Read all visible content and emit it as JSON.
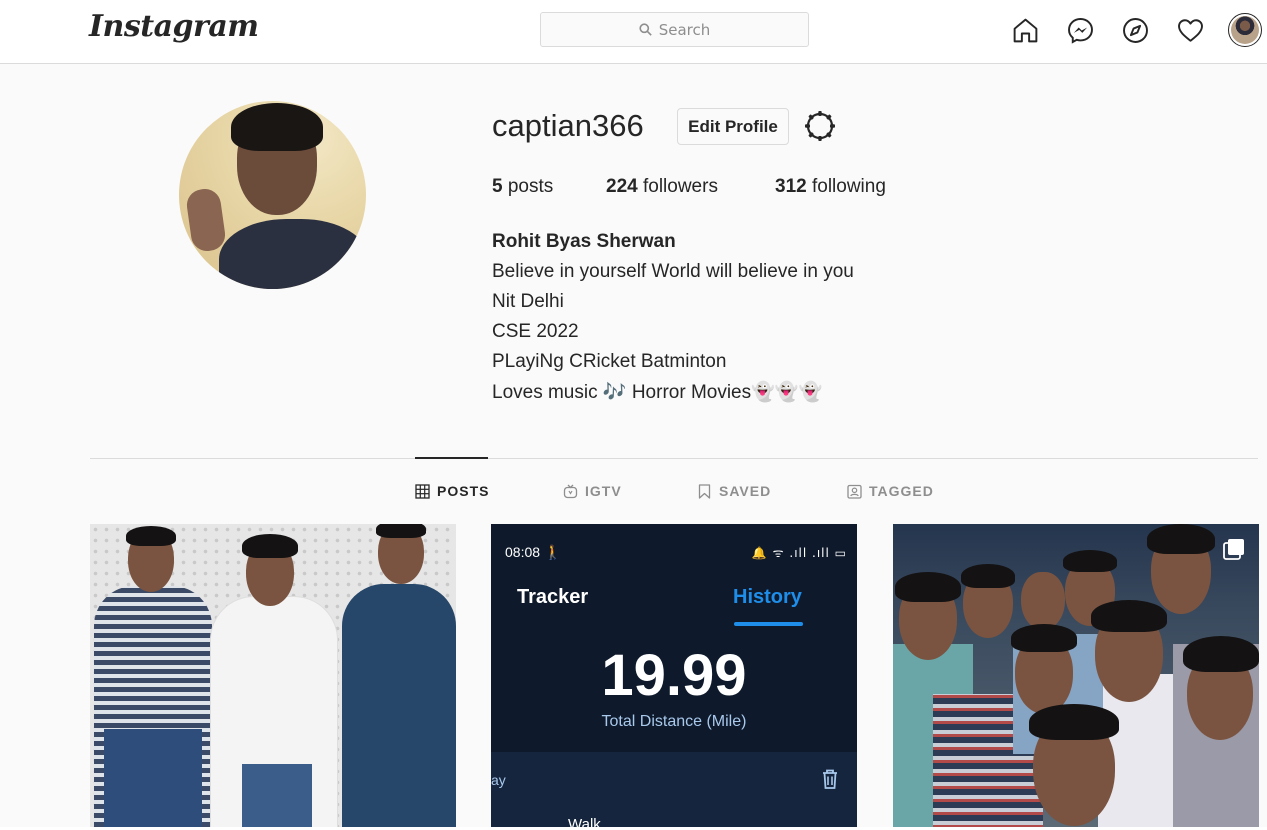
{
  "topbar": {
    "logo": "Instagram",
    "search_placeholder": "Search",
    "icons": [
      "home-icon",
      "messenger-icon",
      "explore-icon",
      "activity-heart-icon",
      "profile-avatar"
    ]
  },
  "profile": {
    "username": "captian366",
    "edit_label": "Edit Profile",
    "stats": {
      "posts_count": "5",
      "posts_label": " posts",
      "followers_count": "224",
      "followers_label": " followers",
      "following_count": "312",
      "following_label": " following"
    },
    "bio": {
      "full_name": "Rohit Byas Sherwan",
      "line1": "Believe in yourself World will believe in you",
      "line2": "Nit Delhi",
      "line3": "CSE 2022",
      "line4": "PLayiNg CRicket Batminton",
      "line5_a": "Loves music ",
      "line5_music": "🎶",
      "line5_b": " Horror Movies",
      "line5_ghosts": "👻👻👻"
    }
  },
  "tabs": [
    {
      "label": "POSTS",
      "icon": "grid-icon",
      "active": true
    },
    {
      "label": "IGTV",
      "icon": "igtv-icon",
      "active": false
    },
    {
      "label": "SAVED",
      "icon": "bookmark-icon",
      "active": false
    },
    {
      "label": "TAGGED",
      "icon": "tagged-icon",
      "active": false
    }
  ],
  "posts": {
    "post2": {
      "time": "08:08",
      "status": "🔔 ᯤ .ıll .ıll ▭",
      "tab_left": "Tracker",
      "tab_right": "History",
      "distance": "19.99",
      "caption": "Total Distance (Mile)",
      "day": "ay",
      "walk": "Walk"
    }
  },
  "colors": {
    "accent_blue": "#1e8eea",
    "border": "#dbdbdb",
    "text": "#262626",
    "muted": "#8e8e8e",
    "background": "#fafafa"
  }
}
